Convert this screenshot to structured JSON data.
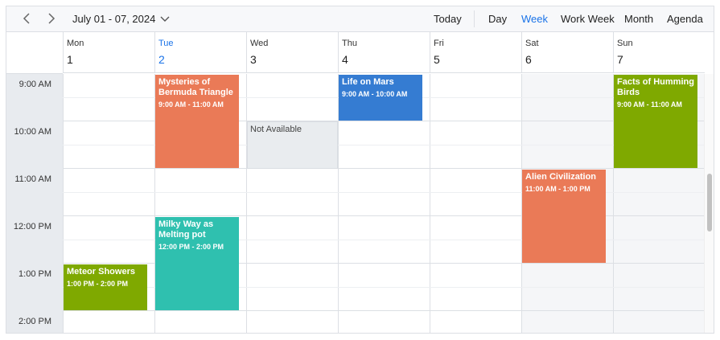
{
  "toolbar": {
    "date_range": "July 01 - 07, 2024",
    "today": "Today",
    "views": [
      {
        "label": "Day",
        "active": false
      },
      {
        "label": "Week",
        "active": true
      },
      {
        "label": "Work Week",
        "active": false
      },
      {
        "label": "Month",
        "active": false
      },
      {
        "label": "Agenda",
        "active": false
      }
    ]
  },
  "days": [
    {
      "name": "Mon",
      "num": "1",
      "today": false
    },
    {
      "name": "Tue",
      "num": "2",
      "today": true
    },
    {
      "name": "Wed",
      "num": "3",
      "today": false
    },
    {
      "name": "Thu",
      "num": "4",
      "today": false
    },
    {
      "name": "Fri",
      "num": "5",
      "today": false
    },
    {
      "name": "Sat",
      "num": "6",
      "today": false
    },
    {
      "name": "Sun",
      "num": "7",
      "today": false
    }
  ],
  "times": [
    "9:00 AM",
    "10:00 AM",
    "11:00 AM",
    "12:00 PM",
    "1:00 PM",
    "2:00 PM"
  ],
  "unavailable": {
    "label": "Not Available",
    "day": 2,
    "start": 10,
    "end": 11
  },
  "events": [
    {
      "title": "Mysteries of Bermuda Triangle",
      "time": "9:00 AM - 11:00 AM",
      "day": 1,
      "start": 9,
      "end": 11,
      "color": "#ea7a57"
    },
    {
      "title": "Life on Mars",
      "time": "9:00 AM - 10:00 AM",
      "day": 3,
      "start": 9,
      "end": 10,
      "color": "#357cd2"
    },
    {
      "title": "Facts of Humming Birds",
      "time": "9:00 AM - 11:00 AM",
      "day": 6,
      "start": 9,
      "end": 11,
      "color": "#7fa900"
    },
    {
      "title": "Alien Civilization",
      "time": "11:00 AM - 1:00 PM",
      "day": 5,
      "start": 11,
      "end": 13,
      "color": "#ea7a57"
    },
    {
      "title": "Milky Way as Melting pot",
      "time": "12:00 PM - 2:00 PM",
      "day": 1,
      "start": 12,
      "end": 14,
      "color": "#2fc0af"
    },
    {
      "title": "Meteor Showers",
      "time": "1:00 PM - 2:00 PM",
      "day": 0,
      "start": 13,
      "end": 14,
      "color": "#7fa900"
    }
  ],
  "colors": {
    "accent": "#1a73e8"
  }
}
